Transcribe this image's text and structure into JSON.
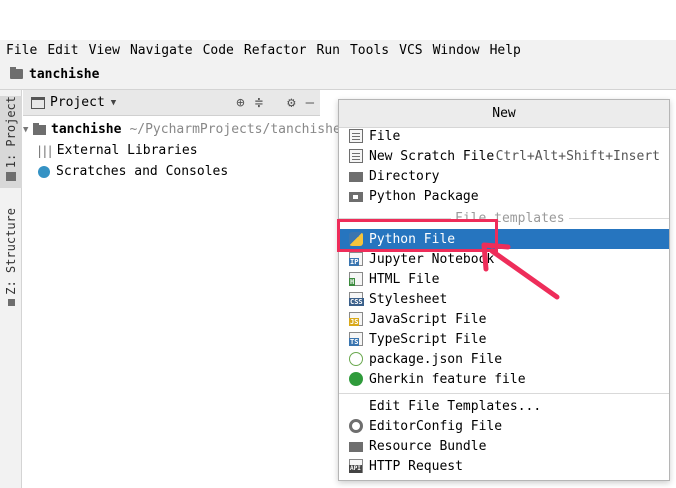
{
  "menubar": [
    "File",
    "Edit",
    "View",
    "Navigate",
    "Code",
    "Refactor",
    "Run",
    "Tools",
    "VCS",
    "Window",
    "Help"
  ],
  "navbar": {
    "crumb": "tanchishe"
  },
  "left_tabs": {
    "project": "1: Project",
    "structure": "Z: Structure"
  },
  "project_panel": {
    "title": "Project",
    "tree": [
      {
        "label": "tanchishe",
        "path": "~/PycharmProjects/tanchishe"
      },
      {
        "label": "External Libraries"
      },
      {
        "label": "Scratches and Consoles"
      }
    ]
  },
  "popup": {
    "title": "New",
    "items_top": [
      {
        "label": "File",
        "icon": "file-icon"
      },
      {
        "label": "New Scratch File",
        "shortcut": "Ctrl+Alt+Shift+Insert",
        "icon": "scratch-file-icon"
      },
      {
        "label": "Directory",
        "icon": "folder-icon"
      },
      {
        "label": "Python Package",
        "icon": "package-icon"
      }
    ],
    "section_label": "File templates",
    "templates": [
      {
        "label": "Python File",
        "icon": "python-icon",
        "selected": true
      },
      {
        "label": "Jupyter Notebook",
        "icon": "jupyter-icon",
        "badge": "IP"
      },
      {
        "label": "HTML File",
        "icon": "html-icon",
        "badge": "H"
      },
      {
        "label": "Stylesheet",
        "icon": "css-icon",
        "badge": "CSS"
      },
      {
        "label": "JavaScript File",
        "icon": "js-icon",
        "badge": "JS"
      },
      {
        "label": "TypeScript File",
        "icon": "ts-icon",
        "badge": "TS"
      },
      {
        "label": "package.json File",
        "icon": "nodejs-icon"
      },
      {
        "label": "Gherkin feature file",
        "icon": "gherkin-icon"
      }
    ],
    "items_bottom": [
      {
        "label": "Edit File Templates..."
      },
      {
        "label": "EditorConfig File",
        "icon": "gear-icon"
      },
      {
        "label": "Resource Bundle",
        "icon": "resource-bundle-icon"
      },
      {
        "label": "HTTP Request",
        "icon": "api-icon",
        "badge": "API"
      }
    ]
  },
  "colors": {
    "selection": "#2675bf",
    "annotation": "#ee2d5a"
  }
}
